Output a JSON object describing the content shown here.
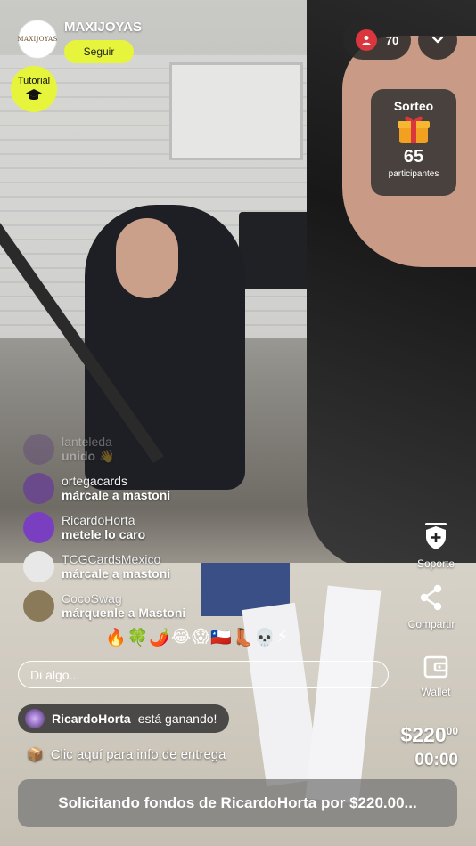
{
  "header": {
    "brand_logo_text": "MAXIJOYAS",
    "brand_name": "MAXIJOYAS",
    "follow_label": "Seguir",
    "tutorial_label": "Tutorial",
    "viewer_count": "70"
  },
  "raffle": {
    "title": "Sorteo",
    "count": "65",
    "subtitle": "participantes"
  },
  "chat": [
    {
      "user": "lanteleda",
      "message": "unido 👋",
      "faded": true,
      "avatar_color": "#5a3a7a"
    },
    {
      "user": "ortegacards",
      "message": "márcale a mastoni",
      "faded": false,
      "avatar_color": "#6a4a8a"
    },
    {
      "user": "RicardoHorta",
      "message": "metele lo caro",
      "faded": false,
      "avatar_color": "#7a3fc0"
    },
    {
      "user": "TCGCardsMexico",
      "message": "márcale a mastoni",
      "faded": false,
      "avatar_color": "#e8e8e8"
    },
    {
      "user": "CocoSwag",
      "message": "márquenle a Mastoni",
      "faded": false,
      "avatar_color": "#8a7a5a"
    }
  ],
  "emojis": [
    "🔥",
    "🍀",
    "🌶️",
    "😂",
    "😱",
    "🇨🇱",
    "👢",
    "💀",
    "⚡"
  ],
  "input": {
    "placeholder": "Di algo..."
  },
  "winner": {
    "user": "RicardoHorta",
    "text": "está ganando!"
  },
  "delivery": {
    "icon": "📦",
    "text": "Clic aquí para info de entrega"
  },
  "price": {
    "main": "$220",
    "cents": "00"
  },
  "timer": "00:00",
  "cta_label": "Solicitando fondos de RicardoHorta por $220.00...",
  "actions": {
    "support_label": "Soporte",
    "share_label": "Compartir",
    "wallet_label": "Wallet"
  },
  "colors": {
    "accent_yellow": "#e6f53b",
    "viewer_red": "#d9363e"
  }
}
